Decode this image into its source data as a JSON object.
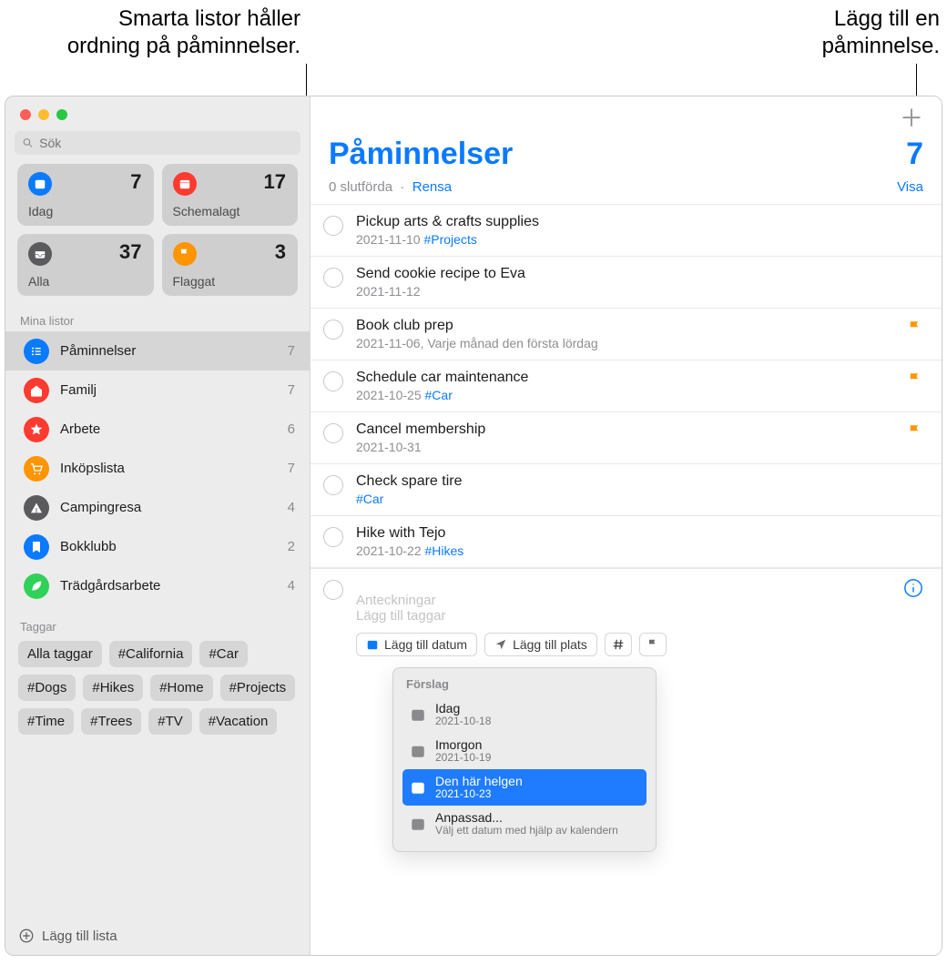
{
  "annotations": {
    "left": "Smarta listor håller\nordning på påminnelser.",
    "right": "Lägg till en\npåminnelse."
  },
  "search": {
    "placeholder": "Sök"
  },
  "smart": [
    {
      "label": "Idag",
      "count": "7",
      "color": "ic-blue",
      "icon": "calendar-today"
    },
    {
      "label": "Schemalagt",
      "count": "17",
      "color": "ic-red",
      "icon": "calendar"
    },
    {
      "label": "Alla",
      "count": "37",
      "color": "ic-gray",
      "icon": "tray"
    },
    {
      "label": "Flaggat",
      "count": "3",
      "color": "ic-orange",
      "icon": "flag"
    }
  ],
  "sections": {
    "myLists": "Mina listor",
    "tags": "Taggar"
  },
  "lists": [
    {
      "name": "Påminnelser",
      "count": "7",
      "color": "#0a7aff",
      "icon": "list",
      "selected": true
    },
    {
      "name": "Familj",
      "count": "7",
      "color": "#ff3b30",
      "icon": "home"
    },
    {
      "name": "Arbete",
      "count": "6",
      "color": "#ff3b30",
      "icon": "star"
    },
    {
      "name": "Inköpslista",
      "count": "7",
      "color": "#ff9500",
      "icon": "cart"
    },
    {
      "name": "Campingresa",
      "count": "4",
      "color": "#5b5b5f",
      "icon": "tent"
    },
    {
      "name": "Bokklubb",
      "count": "2",
      "color": "#0a7aff",
      "icon": "bookmark"
    },
    {
      "name": "Trädgårdsarbete",
      "count": "4",
      "color": "#30d158",
      "icon": "leaf"
    }
  ],
  "tags": [
    "Alla taggar",
    "#California",
    "#Car",
    "#Dogs",
    "#Hikes",
    "#Home",
    "#Projects",
    "#Time",
    "#Trees",
    "#TV",
    "#Vacation"
  ],
  "sidebarFooter": "Lägg till lista",
  "mainHeader": {
    "title": "Påminnelser",
    "count": "7",
    "completed": "0 slutförda",
    "dot": "·",
    "clear": "Rensa",
    "show": "Visa"
  },
  "reminders": [
    {
      "title": "Pickup arts & crafts supplies",
      "meta": "2021-11-10",
      "tag": "#Projects",
      "flag": false
    },
    {
      "title": "Send cookie recipe to Eva",
      "meta": "2021-11-12",
      "tag": "",
      "flag": false
    },
    {
      "title": "Book club prep",
      "meta": "2021-11-06, Varje månad den första lördag",
      "tag": "",
      "flag": true
    },
    {
      "title": "Schedule car maintenance",
      "meta": "2021-10-25",
      "tag": "#Car",
      "flag": true
    },
    {
      "title": "Cancel membership",
      "meta": "2021-10-31",
      "tag": "",
      "flag": true
    },
    {
      "title": "Check spare tire",
      "meta": "",
      "tag": "#Car",
      "flag": false
    },
    {
      "title": "Hike with Tejo",
      "meta": "2021-10-22",
      "tag": "#Hikes",
      "flag": false
    }
  ],
  "newReminder": {
    "notesPlaceholder": "Anteckningar",
    "tagsPlaceholder": "Lägg till taggar",
    "addDate": "Lägg till datum",
    "addLocation": "Lägg till plats"
  },
  "suggestions": {
    "title": "Förslag",
    "items": [
      {
        "label": "Idag",
        "sub": "2021-10-18",
        "selected": false
      },
      {
        "label": "Imorgon",
        "sub": "2021-10-19",
        "selected": false
      },
      {
        "label": "Den här helgen",
        "sub": "2021-10-23",
        "selected": true
      },
      {
        "label": "Anpassad...",
        "sub": "Välj ett datum med hjälp av kalendern",
        "selected": false
      }
    ]
  }
}
